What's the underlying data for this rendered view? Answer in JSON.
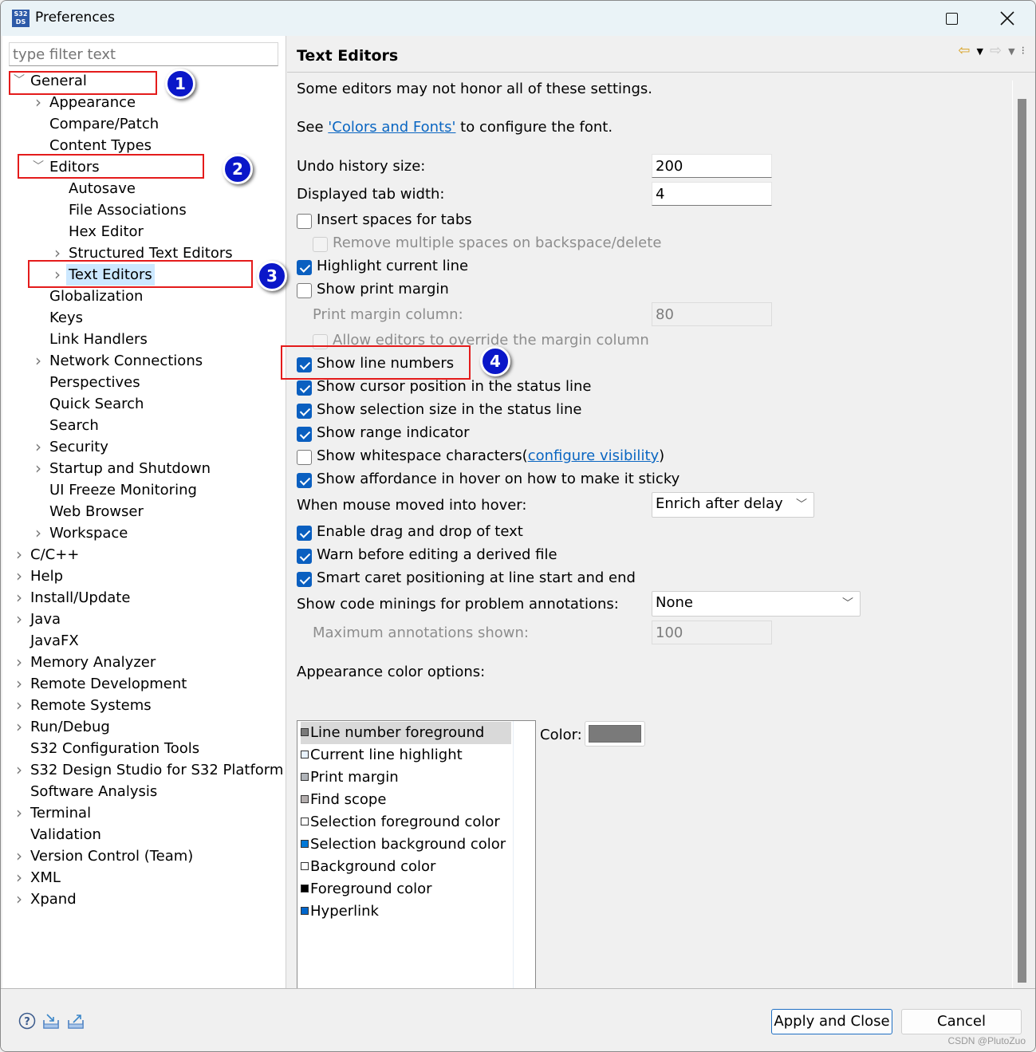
{
  "window": {
    "app_icon_text": "S32 DS",
    "title": "Preferences",
    "maximize_label": "",
    "close_label": "✕"
  },
  "filter": {
    "placeholder": "type filter text",
    "value": ""
  },
  "tree": [
    {
      "label": "General",
      "level": 0,
      "twisty": "expanded"
    },
    {
      "label": "Appearance",
      "level": 1,
      "twisty": "collapsed"
    },
    {
      "label": "Compare/Patch",
      "level": 1,
      "twisty": "none"
    },
    {
      "label": "Content Types",
      "level": 1,
      "twisty": "none"
    },
    {
      "label": "Editors",
      "level": 1,
      "twisty": "expanded"
    },
    {
      "label": "Autosave",
      "level": 2,
      "twisty": "none"
    },
    {
      "label": "File Associations",
      "level": 2,
      "twisty": "none"
    },
    {
      "label": "Hex Editor",
      "level": 2,
      "twisty": "none"
    },
    {
      "label": "Structured Text Editors",
      "level": 2,
      "twisty": "collapsed"
    },
    {
      "label": "Text Editors",
      "level": 2,
      "twisty": "collapsed",
      "selected": true
    },
    {
      "label": "Globalization",
      "level": 1,
      "twisty": "none"
    },
    {
      "label": "Keys",
      "level": 1,
      "twisty": "none"
    },
    {
      "label": "Link Handlers",
      "level": 1,
      "twisty": "none"
    },
    {
      "label": "Network Connections",
      "level": 1,
      "twisty": "collapsed"
    },
    {
      "label": "Perspectives",
      "level": 1,
      "twisty": "none"
    },
    {
      "label": "Quick Search",
      "level": 1,
      "twisty": "none"
    },
    {
      "label": "Search",
      "level": 1,
      "twisty": "none"
    },
    {
      "label": "Security",
      "level": 1,
      "twisty": "collapsed"
    },
    {
      "label": "Startup and Shutdown",
      "level": 1,
      "twisty": "collapsed"
    },
    {
      "label": "UI Freeze Monitoring",
      "level": 1,
      "twisty": "none"
    },
    {
      "label": "Web Browser",
      "level": 1,
      "twisty": "none"
    },
    {
      "label": "Workspace",
      "level": 1,
      "twisty": "collapsed"
    },
    {
      "label": "C/C++",
      "level": 0,
      "twisty": "collapsed"
    },
    {
      "label": "Help",
      "level": 0,
      "twisty": "collapsed"
    },
    {
      "label": "Install/Update",
      "level": 0,
      "twisty": "collapsed"
    },
    {
      "label": "Java",
      "level": 0,
      "twisty": "collapsed"
    },
    {
      "label": "JavaFX",
      "level": 0,
      "twisty": "none"
    },
    {
      "label": "Memory Analyzer",
      "level": 0,
      "twisty": "collapsed"
    },
    {
      "label": "Remote Development",
      "level": 0,
      "twisty": "collapsed"
    },
    {
      "label": "Remote Systems",
      "level": 0,
      "twisty": "collapsed"
    },
    {
      "label": "Run/Debug",
      "level": 0,
      "twisty": "collapsed"
    },
    {
      "label": "S32 Configuration Tools",
      "level": 0,
      "twisty": "none"
    },
    {
      "label": "S32 Design Studio for S32 Platform",
      "level": 0,
      "twisty": "collapsed"
    },
    {
      "label": "Software Analysis",
      "level": 0,
      "twisty": "none"
    },
    {
      "label": "Terminal",
      "level": 0,
      "twisty": "collapsed"
    },
    {
      "label": "Validation",
      "level": 0,
      "twisty": "none"
    },
    {
      "label": "Version Control (Team)",
      "level": 0,
      "twisty": "collapsed"
    },
    {
      "label": "XML",
      "level": 0,
      "twisty": "collapsed"
    },
    {
      "label": "Xpand",
      "level": 0,
      "twisty": "collapsed"
    }
  ],
  "annotations": [
    "1",
    "2",
    "3",
    "4"
  ],
  "page": {
    "title": "Text Editors",
    "intro": "Some editors may not honor all of these settings.",
    "see_prefix": "See ",
    "see_link": "'Colors and Fonts'",
    "see_suffix": " to configure the font.",
    "undo_label": "Undo history size:",
    "undo_value": "200",
    "tab_label": "Displayed tab width:",
    "tab_value": "4",
    "checks": [
      {
        "label": "Insert spaces for tabs",
        "checked": false,
        "enabled": true,
        "indent": false
      },
      {
        "label": "Remove multiple spaces on backspace/delete",
        "checked": false,
        "enabled": false,
        "indent": true
      },
      {
        "label": "Highlight current line",
        "checked": true,
        "enabled": true,
        "indent": false
      },
      {
        "label": "Show print margin",
        "checked": false,
        "enabled": true,
        "indent": false
      }
    ],
    "print_margin_label": "Print margin column:",
    "print_margin_value": "80",
    "checks2": [
      {
        "label": "Allow editors to override the margin column",
        "checked": false,
        "enabled": false,
        "indent": true
      },
      {
        "label": "Show line numbers",
        "checked": true,
        "enabled": true,
        "indent": false
      },
      {
        "label": "Show cursor position in the status line",
        "checked": true,
        "enabled": true,
        "indent": false
      },
      {
        "label": "Show selection size in the status line",
        "checked": true,
        "enabled": true,
        "indent": false
      },
      {
        "label": "Show range indicator",
        "checked": true,
        "enabled": true,
        "indent": false
      },
      {
        "label": "Show whitespace characters",
        "checked": false,
        "enabled": true,
        "indent": false
      },
      {
        "label": "Show affordance in hover on how to make it sticky",
        "checked": true,
        "enabled": true,
        "indent": false
      }
    ],
    "whitespace_link_open": "(",
    "whitespace_link": "configure visibility",
    "whitespace_link_close": ")",
    "hover_label": "When mouse moved into hover:",
    "hover_value": "Enrich after delay",
    "checks3": [
      {
        "label": "Enable drag and drop of text",
        "checked": true
      },
      {
        "label": "Warn before editing a derived file",
        "checked": true
      },
      {
        "label": "Smart caret positioning at line start and end",
        "checked": true
      }
    ],
    "minings_label": "Show code minings for problem annotations:",
    "minings_value": "None",
    "max_annotations_label": "Maximum annotations shown:",
    "max_annotations_value": "100",
    "appearance_label": "Appearance color options:",
    "color_label": "Color:",
    "color_value": "#7a7a7a",
    "color_items": [
      {
        "label": "Line number foreground",
        "swatch": "#7a7a7a",
        "selected": true
      },
      {
        "label": "Current line highlight",
        "swatch": "#e8f2fe"
      },
      {
        "label": "Print margin",
        "swatch": "#b0b4b9"
      },
      {
        "label": "Find scope",
        "swatch": "#b4aeae"
      },
      {
        "label": "Selection foreground color",
        "swatch": "#ffffff"
      },
      {
        "label": "Selection background color",
        "swatch": "#0078d7"
      },
      {
        "label": "Background color",
        "swatch": "#ffffff"
      },
      {
        "label": "Foreground color",
        "swatch": "#000000"
      },
      {
        "label": "Hyperlink",
        "swatch": "#0066cc"
      }
    ]
  },
  "footer": {
    "apply_close": "Apply and Close",
    "cancel": "Cancel",
    "watermark": "CSDN @PlutoZuo"
  },
  "colors": {
    "accent": "#0a5fc0",
    "link": "#0a66c2",
    "annotation_red": "#e41b1b",
    "annotation_blue": "#0a17c9",
    "selection": "#cce8ff"
  }
}
